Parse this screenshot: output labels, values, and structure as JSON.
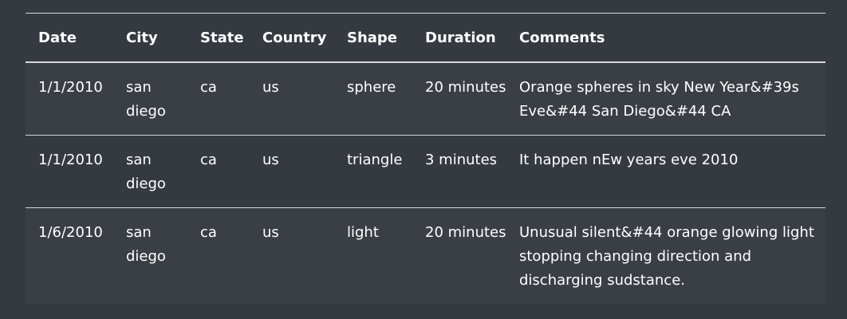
{
  "table": {
    "headers": [
      "Date",
      "City",
      "State",
      "Country",
      "Shape",
      "Duration",
      "Comments"
    ],
    "rows": [
      [
        "1/1/2010",
        "san diego",
        "ca",
        "us",
        "sphere",
        "20 minutes",
        "Orange spheres in sky New Year&#39s Eve&#44 San Diego&#44 CA"
      ],
      [
        "1/1/2010",
        "san diego",
        "ca",
        "us",
        "triangle",
        "3 minutes",
        "It happen nEw years eve 2010"
      ],
      [
        "1/6/2010",
        "san diego",
        "ca",
        "us",
        "light",
        "20 minutes",
        "Unusual silent&#44 orange glowing light stopping changing direction and discharging sudstance."
      ]
    ]
  },
  "colors": {
    "background": "#343a40",
    "row_stripe": "#3a3f45",
    "border": "#d6d8db",
    "text": "#ffffff"
  }
}
